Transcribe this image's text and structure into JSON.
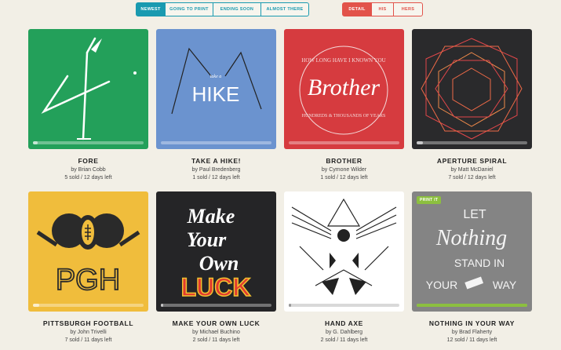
{
  "filters": [
    {
      "label": "NEWEST",
      "active": true
    },
    {
      "label": "GOING TO PRINT",
      "active": false
    },
    {
      "label": "ENDING SOON",
      "active": false
    },
    {
      "label": "ALMOST THERE",
      "active": false
    }
  ],
  "audience": [
    {
      "label": "DETAIL",
      "active": true
    },
    {
      "label": "HIS",
      "active": false
    },
    {
      "label": "HERS",
      "active": false
    }
  ],
  "cards": [
    {
      "title": "FORE",
      "artist": "by Brian Cobb",
      "stats": "5 sold / 12 days left",
      "color": "#23a05a",
      "progress": 0.04
    },
    {
      "title": "TAKE A HIKE!",
      "artist": "by Paul Bredenberg",
      "stats": "1 sold / 12 days left",
      "color": "#6b93cf",
      "progress": 0.0,
      "art_text_small": "take a",
      "art_text_big": "HIKE"
    },
    {
      "title": "BROTHER",
      "artist": "by Cymone Wilder",
      "stats": "1 sold / 12 days left",
      "color": "#d63b3f",
      "progress": 0.0,
      "art_text_top": "HOW LONG HAVE I KNOWN YOU",
      "art_text_main": "Brother",
      "art_text_bottom": "HUNDREDS & THOUSANDS OF YEARS"
    },
    {
      "title": "APERTURE SPIRAL",
      "artist": "by Matt McDaniel",
      "stats": "7 sold / 12 days left",
      "color": "#2a2a2c",
      "progress": 0.06
    },
    {
      "title": "PITTSBURGH FOOTBALL",
      "artist": "by John Trivelli",
      "stats": "7 sold / 11 days left",
      "color": "#f0bd3c",
      "progress": 0.06,
      "art_text_main": "PGH"
    },
    {
      "title": "MAKE YOUR OWN LUCK",
      "artist": "by Michael Buchino",
      "stats": "2 sold / 11 days left",
      "color": "#252527",
      "progress": 0.02,
      "art_text_lines": [
        "Make",
        "Your",
        "Own"
      ],
      "art_text_main": "LUCK"
    },
    {
      "title": "HAND AXE",
      "artist": "by G. Dahlberg",
      "stats": "2 sold / 11 days left",
      "color": "#ffffff",
      "progress": 0.02
    },
    {
      "title": "NOTHING IN YOUR WAY",
      "artist": "by Brad Flaherty",
      "stats": "12 sold / 11 days left",
      "color": "#848484",
      "progress": 1.0,
      "badge": "PRINT IT",
      "art_text_lines": [
        "LET",
        "Nothing",
        "STAND IN",
        "YOUR",
        "WAY"
      ]
    }
  ]
}
